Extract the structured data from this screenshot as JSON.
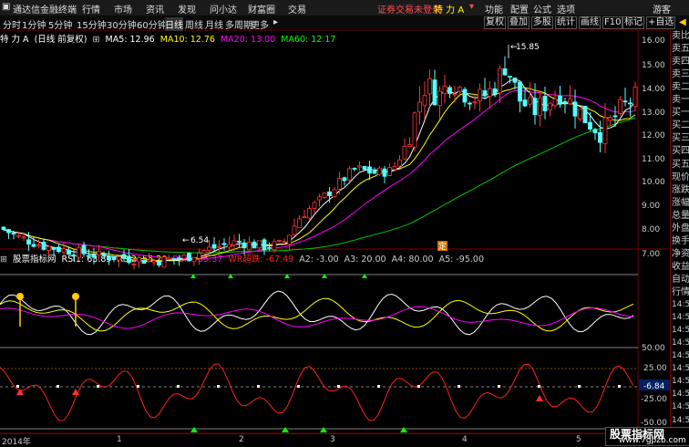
{
  "titlebar": {
    "app_name": "通达信金融终端",
    "menu": [
      "行情",
      "市场",
      "资讯",
      "发现",
      "问小达",
      "财富圈",
      "交易"
    ],
    "notice": "证券交易未登录",
    "stock": "特 力 A",
    "func": [
      "功能",
      "配置",
      "公式",
      "选项"
    ],
    "guest": "游客"
  },
  "toolbar": {
    "periods": [
      "分时",
      "1分钟",
      "5分钟",
      "15分钟",
      "30分钟",
      "60分钟",
      "日线",
      "周线",
      "月线",
      "多周期",
      "更多"
    ],
    "active_period": "日线",
    "right_buttons": [
      "复权",
      "叠加",
      "多股",
      "统计",
      "画线",
      "F10",
      "标记",
      "+自选"
    ],
    "back_arrow": "◀"
  },
  "main_legend": {
    "name": "特 力 A",
    "mode": "(日线 前复权)",
    "ma5": "MA5: 12.96",
    "ma10": "MA10: 12.76",
    "ma20": "MA20: 13.00",
    "ma60": "MA60: 12.17"
  },
  "sub_legend": {
    "name": "股票指标网",
    "rsi1": "RSI1: 63.89",
    "rsi2": "RSI2: 55.20",
    "rsi3": "RSI3: 55.37",
    "wr": "WR超跌: -67.49",
    "a2": "A2: -3.00",
    "a3": "A3: 20.00",
    "a4": "A4: 80.00",
    "a5": "A5: -95.00"
  },
  "price_axis": [
    "16.00",
    "15.00",
    "14.00",
    "13.00",
    "12.00",
    "11.00",
    "10.00",
    "9.00",
    "8.00",
    "7.00"
  ],
  "sub_axis": [
    "50.00",
    "25.00",
    "-6.84",
    "-25.00",
    "-50.00",
    "-75.00"
  ],
  "annotations": {
    "high": "15.85",
    "low": "6.54",
    "marker": "定"
  },
  "right_panel": [
    "卖比",
    "卖五",
    "卖四",
    "卖三",
    "卖二",
    "卖一",
    "买一",
    "买二",
    "买三",
    "买四",
    "买五",
    "现价",
    "涨跌",
    "涨幅",
    "总量",
    "外盘",
    "换手",
    "净资",
    "收益",
    "自动",
    "行情",
    "14:56",
    "14:56",
    "14:56",
    "14:56",
    "14:56",
    "14:56",
    "14:56",
    "14:56",
    "14:56",
    "14:56"
  ],
  "x_axis": {
    "year": "2014年",
    "months": [
      "1",
      "2",
      "3",
      "4",
      "5"
    ]
  },
  "watermark": {
    "line1": "股票指标网",
    "line2": "www.7gpzb.com"
  },
  "colors": {
    "up": "#ff3232",
    "down": "#54ffff",
    "ma5": "#ffffff",
    "ma10": "#ffff00",
    "ma20": "#ff00ff",
    "ma60": "#00c800",
    "wr": "#ff2020",
    "accent_red": "#7a0000"
  }
}
